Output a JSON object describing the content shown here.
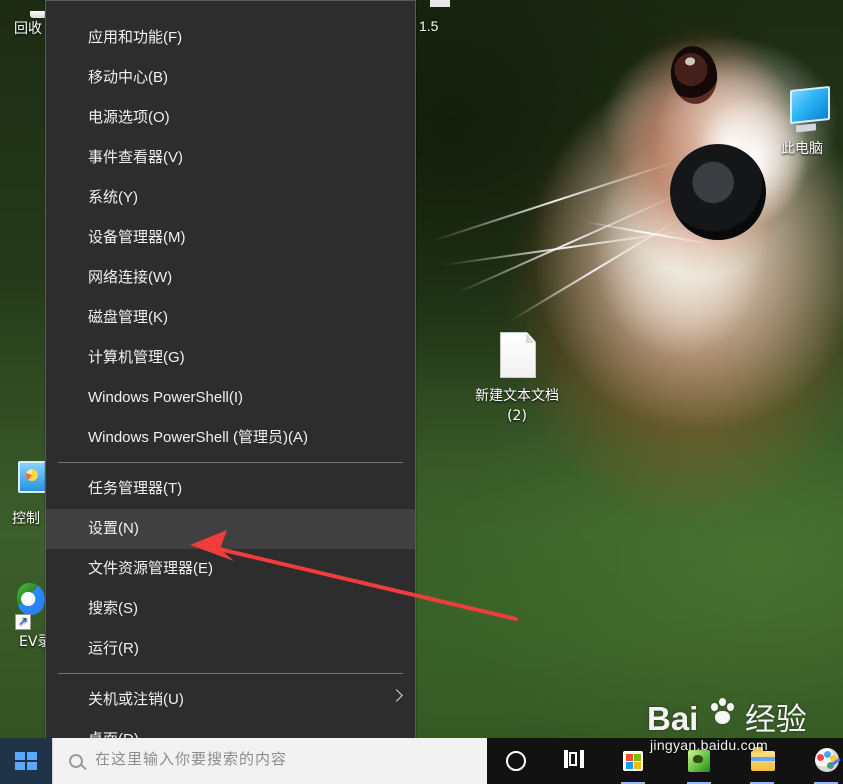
{
  "desktop": {
    "top_label": "1.5",
    "icons": {
      "recycle_bin": "回收",
      "this_pc": "此电脑",
      "new_text_document": "新建文本文档\n(2)",
      "control_panel": "控制",
      "ev_recorder": "EV录"
    }
  },
  "context_menu": {
    "items": [
      {
        "label": "应用和功能(F)"
      },
      {
        "label": "移动中心(B)"
      },
      {
        "label": "电源选项(O)"
      },
      {
        "label": "事件查看器(V)"
      },
      {
        "label": "系统(Y)"
      },
      {
        "label": "设备管理器(M)"
      },
      {
        "label": "网络连接(W)"
      },
      {
        "label": "磁盘管理(K)"
      },
      {
        "label": "计算机管理(G)"
      },
      {
        "label": "Windows PowerShell(I)"
      },
      {
        "label": "Windows PowerShell (管理员)(A)"
      },
      {
        "label": "任务管理器(T)"
      },
      {
        "label": "设置(N)"
      },
      {
        "label": "文件资源管理器(E)"
      },
      {
        "label": "搜索(S)"
      },
      {
        "label": "运行(R)"
      },
      {
        "label": "关机或注销(U)"
      },
      {
        "label": "桌面(D)"
      }
    ],
    "highlighted_item": "设置(N)",
    "submenu_icon": "chevron-right-icon"
  },
  "taskbar": {
    "search_text": "在这里输入你要搜索的内容",
    "icons": [
      "windows-start-icon",
      "cortana-icon",
      "task-view-icon",
      "microsoft-store-icon",
      "photos-icon",
      "file-explorer-icon",
      "paint-icon"
    ]
  },
  "annotation": {
    "arrow_color": "#f03c3c"
  },
  "watermark": {
    "brand_left": "Bai",
    "brand_right": "经验",
    "url": "jingyan.baidu.com"
  },
  "colors": {
    "menu_background": "#2d2d2d",
    "menu_hover": "#404040",
    "taskbar_background": "#121212",
    "start_accent": "#58a9ff"
  }
}
